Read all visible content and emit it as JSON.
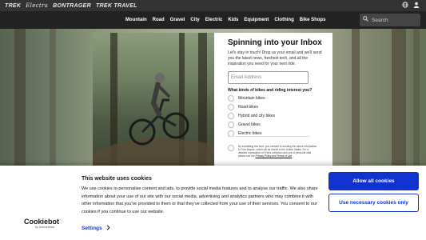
{
  "brands": [
    "TREK",
    "Electra",
    "BONTRAGER",
    "TREK",
    "TRAVEL"
  ],
  "nav": {
    "links": [
      "Mountain",
      "Road",
      "Gravel",
      "City",
      "Electric",
      "Kids",
      "Equipment",
      "Clothing",
      "Bike Shops"
    ],
    "search_placeholder": "Search"
  },
  "icons": {
    "globe": "globe-icon",
    "account": "user-icon",
    "search": "search-icon",
    "chevron": "chevron-right-icon"
  },
  "newsletter": {
    "title": "Spinning into your Inbox",
    "intro": "Let's stay in touch! Drop us your email and we'll send you the latest news, freshest tech, and all the inspiration you need for your next ride.",
    "email_placeholder": "Email Address",
    "question": "What kinds of bikes and riding interest you?",
    "options": [
      "Mountain bikes",
      "Road bikes",
      "Hybrid and city bikes",
      "Gravel bikes",
      "Electric bikes"
    ],
    "consent_text": "By submitting this form, you consent to sending the above information to Trek Bicycle, which will be stored in the United States. For a detailed explanation of Trek's collection and use of personal data please see the",
    "consent_link": "Privacy Policy and Terms of Use"
  },
  "cookie": {
    "title": "This website uses cookies",
    "body": "We use cookies to personalise content and ads, to provide social media features and to analyse our traffic. We also share information about your use of our site with our social media, advertising and analytics partners who may combine it with other information that you've provided to them or that they've collected from your use of their services. You consent to our cookies if you continue to use our website.",
    "logo": "Cookiebot",
    "logo_sub": "by Usercentrics",
    "settings_label": "Settings",
    "allow_all_label": "Allow all cookies",
    "necessary_label": "Use necessary cookies only",
    "accent_color": "#1032cf"
  }
}
